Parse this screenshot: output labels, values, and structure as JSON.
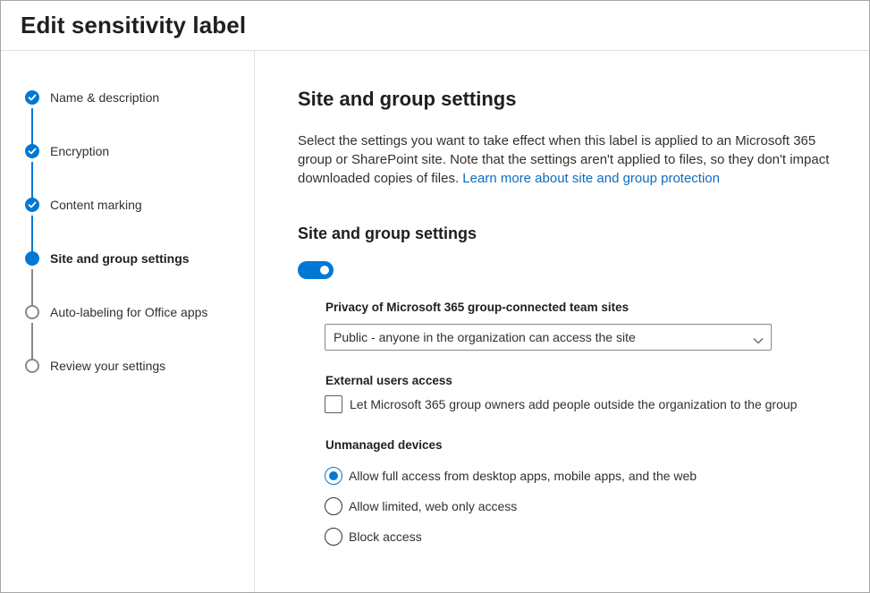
{
  "header": {
    "title": "Edit sensitivity label"
  },
  "steps": [
    {
      "label": "Name & description",
      "state": "done"
    },
    {
      "label": "Encryption",
      "state": "done"
    },
    {
      "label": "Content marking",
      "state": "done"
    },
    {
      "label": "Site and group settings",
      "state": "current"
    },
    {
      "label": "Auto-labeling for Office apps",
      "state": "todo"
    },
    {
      "label": "Review your settings",
      "state": "todo"
    }
  ],
  "main": {
    "title": "Site and group settings",
    "description": "Select the settings you want to take effect when this label is applied to an Microsoft 365 group or SharePoint site. Note that the settings aren't applied to files, so they don't impact downloaded copies of files.",
    "learn_more_link": "Learn more about site and group protection",
    "section_title": "Site and group settings",
    "toggle_on": true,
    "privacy": {
      "label": "Privacy of Microsoft 365 group-connected team sites",
      "selected": "Public - anyone in the organization can access the site"
    },
    "external": {
      "label": "External users access",
      "checkbox_label": "Let Microsoft 365 group owners add people outside the organization to the group",
      "checked": false
    },
    "unmanaged": {
      "label": "Unmanaged devices",
      "options": [
        {
          "label": "Allow full access from desktop apps, mobile apps, and the web",
          "selected": true
        },
        {
          "label": "Allow limited, web only access",
          "selected": false
        },
        {
          "label": "Block access",
          "selected": false
        }
      ]
    }
  },
  "colors": {
    "accent": "#0078d4",
    "link": "#0f6cbd",
    "inactive": "#8a8886"
  },
  "icons": {
    "done_step": "checkmark-icon",
    "dropdown": "chevron-down-icon"
  }
}
